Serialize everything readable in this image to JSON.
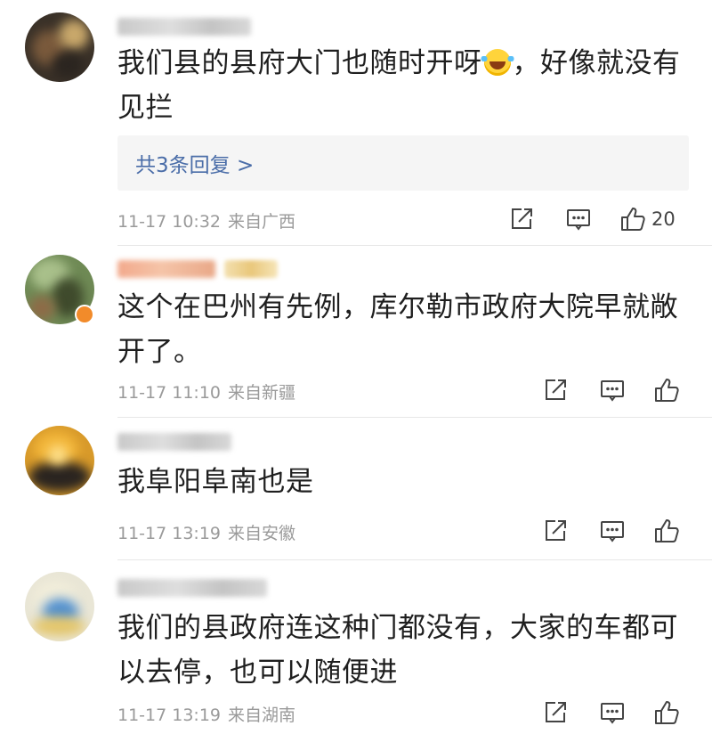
{
  "comments": [
    {
      "text_parts": [
        "我们县的县府大门也随时开呀",
        "，好像就没有见拦"
      ],
      "emoji": "laughing-tears-emoji",
      "replies_label": "共3条回复 >",
      "time": "11-17 10:32",
      "location": "来自广西",
      "like_count": "20"
    },
    {
      "text": "这个在巴州有先例，库尔勒市政府大院早就敞开了。",
      "time": "11-17 11:10",
      "location": "来自新疆"
    },
    {
      "text": "我阜阳阜南也是",
      "time": "11-17 13:19",
      "location": "来自安徽"
    },
    {
      "text": "我们的县政府连这种门都没有，大家的车都可以去停，也可以随便进",
      "time": "11-17 13:19",
      "location": "来自湖南"
    }
  ],
  "icons": {
    "share": "share-icon",
    "comment": "comment-icon",
    "like": "thumbs-up-icon"
  },
  "colors": {
    "link": "#4a6da8",
    "meta": "#9a9a9a",
    "replies_bg": "#f5f5f5"
  }
}
